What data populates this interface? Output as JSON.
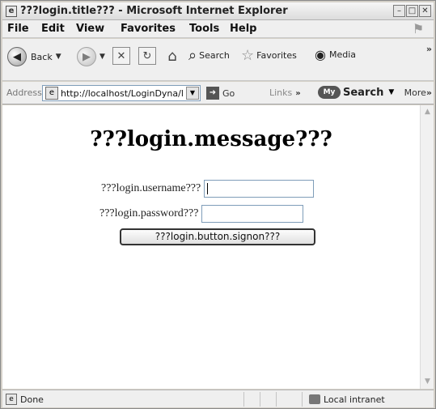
{
  "window": {
    "title": "???login.title??? - Microsoft Internet Explorer"
  },
  "menubar": {
    "items": [
      "File",
      "Edit",
      "View",
      "Favorites",
      "Tools",
      "Help"
    ]
  },
  "toolbar": {
    "back_label": "Back",
    "search_label": "Search",
    "favorites_label": "Favorites",
    "media_label": "Media",
    "overflow": "»"
  },
  "addressbar": {
    "label": "Address",
    "url": "http://localhost/LoginDyna/lc",
    "go_label": "Go",
    "links_label": "Links",
    "links_chevron": "»",
    "mysearch_logo": "My",
    "mysearch_label": "Search",
    "more_label": "More",
    "more_chevron": "»"
  },
  "page": {
    "heading": "???login.message???",
    "username_label": "???login.username???",
    "username_value": "",
    "password_label": "???login.password???",
    "password_value": "",
    "signon_button": "???login.button.signon???"
  },
  "statusbar": {
    "status": "Done",
    "zone": "Local intranet"
  }
}
